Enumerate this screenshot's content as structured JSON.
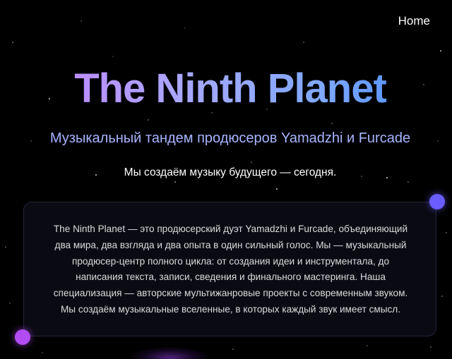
{
  "nav": {
    "home_label": "Home"
  },
  "hero": {
    "title": "The Ninth Planet",
    "subtitle": "Музыкальный тандем продюсеров Yamadzhi и Furcade",
    "tagline": "Мы создаём музыку будущего — сегодня."
  },
  "about": {
    "line1": "The Ninth Planet — это продюсерский дуэт Yamadzhi и Furcade, объединяющий",
    "line2": "два мира, два взгляда и два опыта в один сильный голос. Мы — музыкальный",
    "line3": "продюсер-центр полного цикла: от создания идеи и инструментала, до",
    "line4": "написания текста, записи, сведения и финального мастеринга. Наша",
    "line5": "специализация — авторские мультижанровые проекты с современным звуком.",
    "line6": "Мы создаём музыкальные вселенные, в которых каждый звук имеет смысл."
  },
  "colors": {
    "background": "#000000",
    "title_gradient_start": "#c77dff",
    "title_gradient_end": "#3a86ff",
    "subtitle": "#a8b4ff",
    "dot_purple": "#b14cf2",
    "dot_blue": "#6a5cff"
  }
}
